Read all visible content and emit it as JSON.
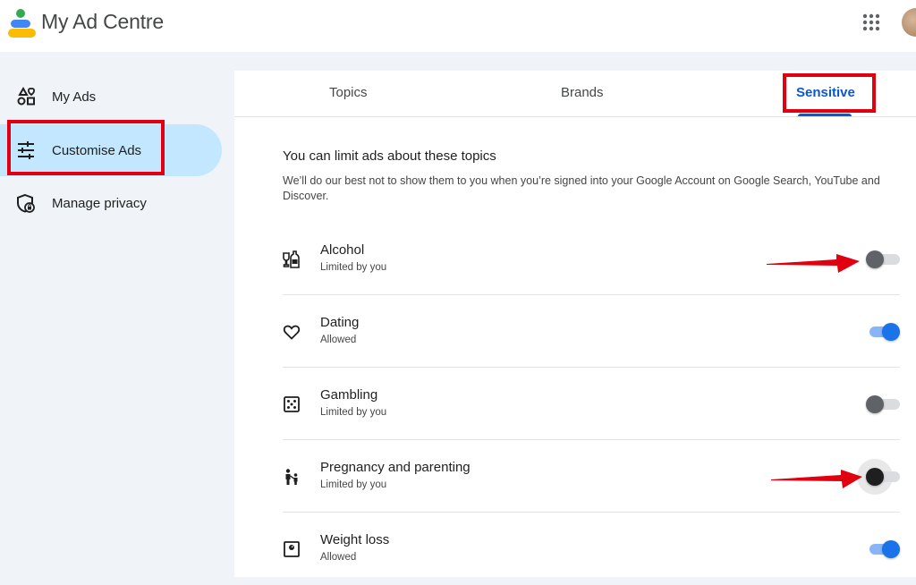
{
  "header": {
    "title": "My Ad Centre",
    "icons": [
      "google-logo",
      "apps-grid-icon",
      "account-avatar"
    ]
  },
  "sidebar": {
    "items": [
      {
        "label": "My Ads",
        "icon": "ads-shapes-icon",
        "active": false
      },
      {
        "label": "Customise Ads",
        "icon": "tune-sliders-icon",
        "active": true
      },
      {
        "label": "Manage privacy",
        "icon": "privacy-shield-icon",
        "active": false
      }
    ]
  },
  "tabs": [
    {
      "label": "Topics",
      "selected": false
    },
    {
      "label": "Brands",
      "selected": false
    },
    {
      "label": "Sensitive",
      "selected": true
    }
  ],
  "section": {
    "title": "You can limit ads about these topics",
    "description": "We’ll do our best not to show them to you when you’re signed into your Google Account on Google Search, YouTube and Discover."
  },
  "topics": [
    {
      "name": "Alcohol",
      "status": "Limited by you",
      "enabled": false,
      "icon": "wine-bottle-icon"
    },
    {
      "name": "Dating",
      "status": "Allowed",
      "enabled": true,
      "icon": "heart-icon"
    },
    {
      "name": "Gambling",
      "status": "Limited by you",
      "enabled": false,
      "icon": "dice-icon"
    },
    {
      "name": "Pregnancy and parenting",
      "status": "Limited by you",
      "enabled": false,
      "icon": "parent-child-icon"
    },
    {
      "name": "Weight loss",
      "status": "Allowed",
      "enabled": true,
      "icon": "scale-icon"
    }
  ],
  "colors": {
    "accent": "#0b57d0",
    "toggle_on": "#1a73e8",
    "highlight_red": "#e1000f",
    "active_nav": "#c2e7ff"
  }
}
